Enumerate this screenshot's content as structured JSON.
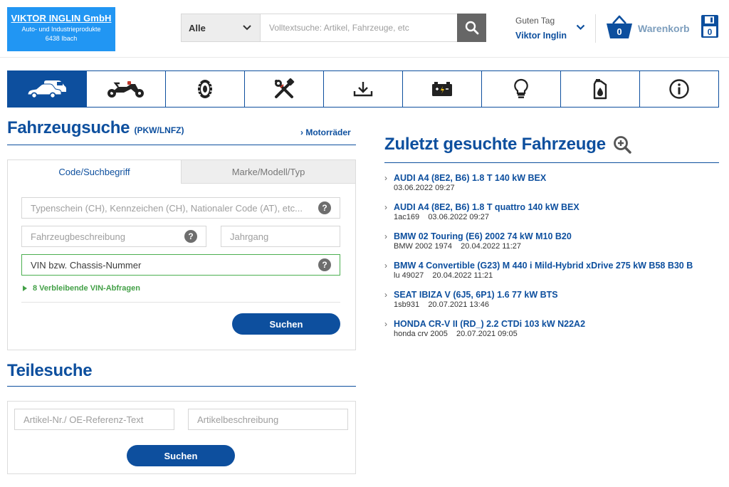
{
  "header": {
    "company_name": "VIKTOR INGLIN GmbH",
    "company_sub1": "Auto- und Industrieprodukte",
    "company_sub2": "6438 Ibach",
    "search_category": "Alle",
    "search_placeholder": "Volltextsuche: Artikel, Fahrzeuge, etc",
    "greeting": "Guten Tag",
    "user_name": "Viktor Inglin",
    "cart_count": "0",
    "cart_label": "Warenkorb",
    "saved_count": "0"
  },
  "categories": [
    {
      "icon": "car-van-icon",
      "active": true
    },
    {
      "icon": "motorcycle-icon",
      "active": false
    },
    {
      "icon": "tire-icon",
      "active": false
    },
    {
      "icon": "tools-icon",
      "active": false
    },
    {
      "icon": "download-icon",
      "active": false
    },
    {
      "icon": "battery-icon",
      "active": false
    },
    {
      "icon": "bulb-icon",
      "active": false
    },
    {
      "icon": "oil-can-icon",
      "active": false
    },
    {
      "icon": "info-icon",
      "active": false
    }
  ],
  "vehicle_search": {
    "title": "Fahrzeugsuche",
    "title_suffix": "(PKW/LNFZ)",
    "moto_link": "Motorräder",
    "tab_code": "Code/Suchbegriff",
    "tab_brand": "Marke/Modell/Typ",
    "typenschein_placeholder": "Typenschein (CH), Kennzeichen (CH), Nationaler Code (AT), etc...",
    "description_placeholder": "Fahrzeugbeschreibung",
    "year_placeholder": "Jahrgang",
    "vin_placeholder": "VIN bzw. Chassis-Nummer",
    "vin_remaining": "8 Verbleibende VIN-Abfragen",
    "search_button": "Suchen"
  },
  "parts_search": {
    "title": "Teilesuche",
    "article_placeholder": "Artikel-Nr./ OE-Referenz-Text",
    "description_placeholder": "Artikelbeschreibung",
    "search_button": "Suchen"
  },
  "recent": {
    "title": "Zuletzt gesuchte Fahrzeuge",
    "items": [
      {
        "title": "AUDI A4 (8E2, B6) 1.8 T 140 kW BEX",
        "meta": "03.06.2022 09:27"
      },
      {
        "title": "AUDI A4 (8E2, B6) 1.8 T quattro 140 kW BEX",
        "meta": "1ac169    03.06.2022 09:27"
      },
      {
        "title": "BMW 02 Touring (E6) 2002 74 kW M10 B20",
        "meta": "BMW 2002 1974    20.04.2022 11:27"
      },
      {
        "title": "BMW 4 Convertible (G23) M 440 i Mild-Hybrid xDrive 275 kW B58 B30 B",
        "meta": "lu 49027    20.04.2022 11:21"
      },
      {
        "title": "SEAT IBIZA V (6J5, 6P1) 1.6 77 kW BTS",
        "meta": "1sb931    20.07.2021 13:46"
      },
      {
        "title": "HONDA CR-V II (RD_) 2.2 CTDi 103 kW N22A2",
        "meta": "honda crv 2005    20.07.2021 09:05"
      }
    ]
  },
  "colors": {
    "brand_blue": "#0d4f9e",
    "logo_blue": "#2196f3",
    "vin_green": "#43a047"
  }
}
